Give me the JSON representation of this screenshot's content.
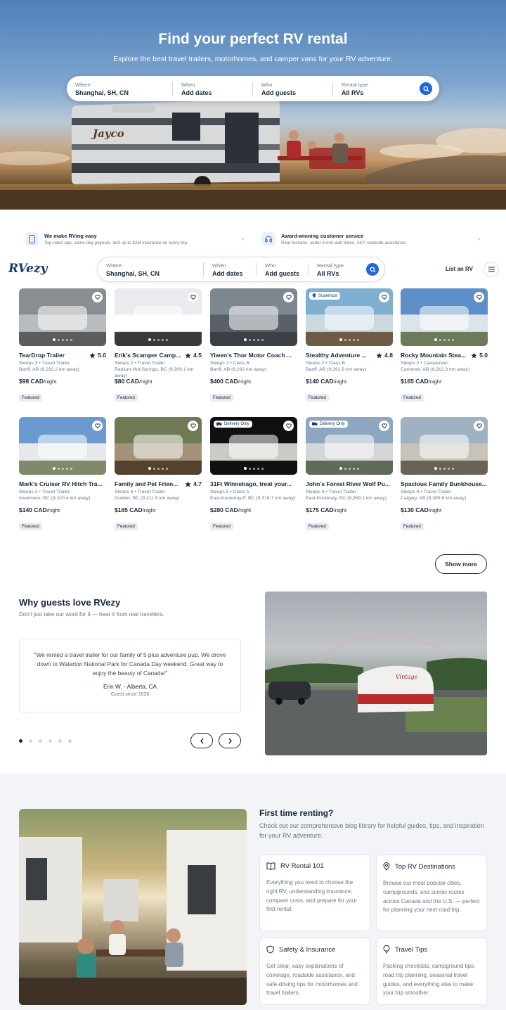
{
  "hero": {
    "title": "Find your perfect RV rental",
    "subtitle": "Explore the best travel trailers, motorhomes, and camper vans for your RV adventure.",
    "trailer_brand": "Jayco",
    "search": {
      "where_label": "Where",
      "where_value": "Shanghai, SH, CN",
      "when_label": "When",
      "when_value": "Add dates",
      "who_label": "Who",
      "who_value": "Add guests",
      "type_label": "Rental type",
      "type_value": "All RVs"
    }
  },
  "features": [
    {
      "title": "We make RVing easy",
      "desc": "Top-rated app, same-day payouts, and up to $2M insurance on every trip.",
      "icon": "phone-icon"
    },
    {
      "title": "Award-winning customer service",
      "desc": "Real humans, under 5-min wait times, 24/7 roadside assistance.",
      "icon": "headset-icon"
    }
  ],
  "header": {
    "logo": "RVezy",
    "search": {
      "where_label": "Where",
      "where_value": "Shanghai, SH, CN",
      "when_label": "When",
      "when_value": "Add dates",
      "who_label": "Who",
      "who_value": "Add guests",
      "type_label": "Rental type",
      "type_value": "All RVs"
    },
    "list_rv": "List an RV"
  },
  "listings": [
    {
      "name": "TearDrop Trailer",
      "rating": "5.0",
      "sleeps": "Sleeps 3 • Travel Trailer",
      "location": "Banff, AB (9,292.2 km away)",
      "price": "$98 CAD",
      "per": "/night",
      "tag": "Featured",
      "badge": ""
    },
    {
      "name": "Erik's Scamper Camp...",
      "rating": "4.5",
      "sleeps": "Sleeps 2 • Travel Trailer",
      "location": "Radium-Hot-Springs, BC (9,309.1 km away)",
      "price": "$80 CAD",
      "per": "/night",
      "tag": "Featured",
      "badge": ""
    },
    {
      "name": "Yiwen's Thor Motor Coach ...",
      "rating": "",
      "sleeps": "Sleeps 2 • Class B",
      "location": "Banff, AB (9,292 km away)",
      "price": "$400 CAD",
      "per": "/night",
      "tag": "Featured",
      "badge": ""
    },
    {
      "name": "Stealthy Adventure ...",
      "rating": "4.8",
      "sleeps": "Sleeps 2 • Class B",
      "location": "Banff, AB (9,291.9 km away)",
      "price": "$140 CAD",
      "per": "/night",
      "tag": "Featured",
      "badge": "Superhost"
    },
    {
      "name": "Rocky Mountain Stea...",
      "rating": "5.0",
      "sleeps": "Sleeps 2 • Campervan",
      "location": "Canmore, AB (9,312.3 km away)",
      "price": "$165 CAD",
      "per": "/night",
      "tag": "Featured",
      "badge": ""
    },
    {
      "name": "Mark's Cruiser RV Hitch Tra...",
      "rating": "",
      "sleeps": "Sleeps 2 • Travel Trailer",
      "location": "Invermere, BC (9,320.4 km away)",
      "price": "$140 CAD",
      "per": "/night",
      "tag": "Featured",
      "badge": ""
    },
    {
      "name": "Family and Pet Frien...",
      "rating": "4.7",
      "sleeps": "Sleeps 6 • Travel Trailer",
      "location": "Golden, BC (9,211.5 km away)",
      "price": "$165 CAD",
      "per": "/night",
      "tag": "Featured",
      "badge": ""
    },
    {
      "name": "31Ft Winnebago, treat your...",
      "rating": "",
      "sleeps": "Sleeps 5 • Class A",
      "location": "East-Kootenay-F, BC (9,316.7 km away)",
      "price": "$280 CAD",
      "per": "/night",
      "tag": "Featured",
      "badge": "Delivery Only"
    },
    {
      "name": "John's Forest River Wolf Pu...",
      "rating": "",
      "sleeps": "Sleeps 6 • Travel Trailer",
      "location": "East-Kootenay, BC (9,359.1 km away)",
      "price": "$175 CAD",
      "per": "/night",
      "tag": "Featured",
      "badge": "Delivery Only"
    },
    {
      "name": "Spacious Family Bunkhouse...",
      "rating": "",
      "sleeps": "Sleeps 8 • Travel Trailer",
      "location": "Calgary, AB (9,385.6 km away)",
      "price": "$130 CAD",
      "per": "/night",
      "tag": "Featured",
      "badge": ""
    }
  ],
  "show_more": "Show more",
  "reviews": {
    "title": "Why guests love RVezy",
    "subtitle": "Don't just take our word for it — hear it from real travellers.",
    "quote": "\"We rented a travel trailer for our family of 5 plus adventure pup. We drove down to Waterton National Park for Canada Day weekend. Great way to enjoy the beauty of Canada!\"",
    "author": "Erin W. - Alberta, CA",
    "since": "Guest since 2020",
    "trailer_brand": "Vintage"
  },
  "blog": {
    "title": "First time renting?",
    "subtitle": "Check out our comprehensive blog library for helpful guides, tips, and inspiration for your RV adventure.",
    "cards": [
      {
        "title": "RV Rental 101",
        "desc": "Everything you need to choose the right RV, understanding insurance, compare costs, and prepare for your first rental.",
        "icon": "book-icon"
      },
      {
        "title": "Top RV Destinations",
        "desc": "Browse our most popular cities, campgrounds, and scenic routes across Canada and the U.S. — perfect for planning your next road trip.",
        "icon": "map-pin-icon"
      },
      {
        "title": "Safety & Insurance",
        "desc": "Get clear, easy explanations of coverage, roadside assistance, and safe-driving tips for motorhomes and travel trailers.",
        "icon": "shield-icon"
      },
      {
        "title": "Travel Tips",
        "desc": "Packing checklists, campground tips, road trip planning, seasonal travel guides, and everything else to make your trip smoother.",
        "icon": "lightbulb-icon"
      }
    ]
  },
  "colors": {
    "accent": "#2167d8",
    "text": "#17283a",
    "muted": "#6b7785"
  }
}
